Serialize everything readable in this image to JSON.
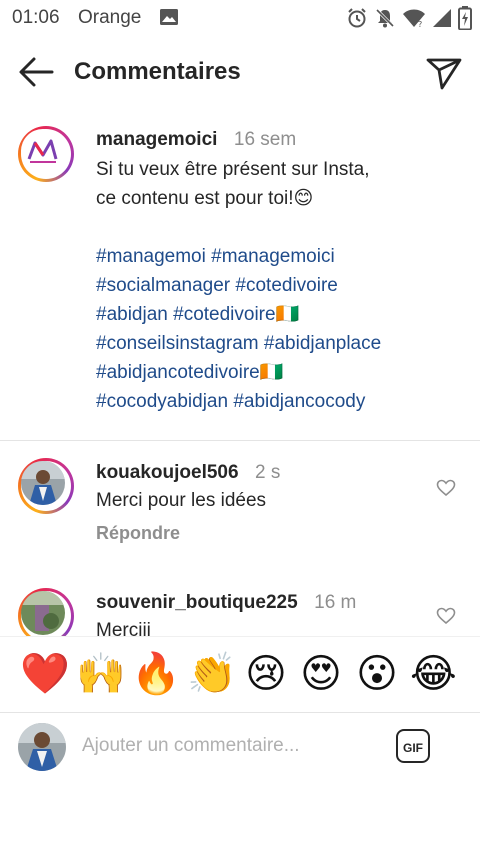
{
  "status_bar": {
    "time": "01:06",
    "carrier": "Orange"
  },
  "header": {
    "title": "Commentaires"
  },
  "caption": {
    "username": "managemoici",
    "time": "16 sem",
    "lines": [
      "Si tu veux être présent sur Insta,",
      "ce contenu est pour toi!😊"
    ],
    "hashtags": [
      "#managemoi #managemoici",
      "#socialmanager #cotedivoire",
      "#abidjan #cotedivoire🇨🇮",
      "#conseilsinstagram #abidjanplace",
      "#abidjancotedivoire🇨🇮",
      "#cocodyabidjan #abidjancocody"
    ]
  },
  "comments": [
    {
      "username": "kouakoujoel506",
      "time": "2 s",
      "text": "Merci pour les idées",
      "reply_label": "Répondre"
    },
    {
      "username": "souvenir_boutique225",
      "time": "16 m",
      "text": "Merciii"
    }
  ],
  "emoji_bar": [
    "❤️",
    "🙌",
    "🔥",
    "👏",
    "😢",
    "😍",
    "😮",
    "😂"
  ],
  "composer": {
    "placeholder": "Ajouter un commentaire...",
    "gif_label": "GIF"
  }
}
